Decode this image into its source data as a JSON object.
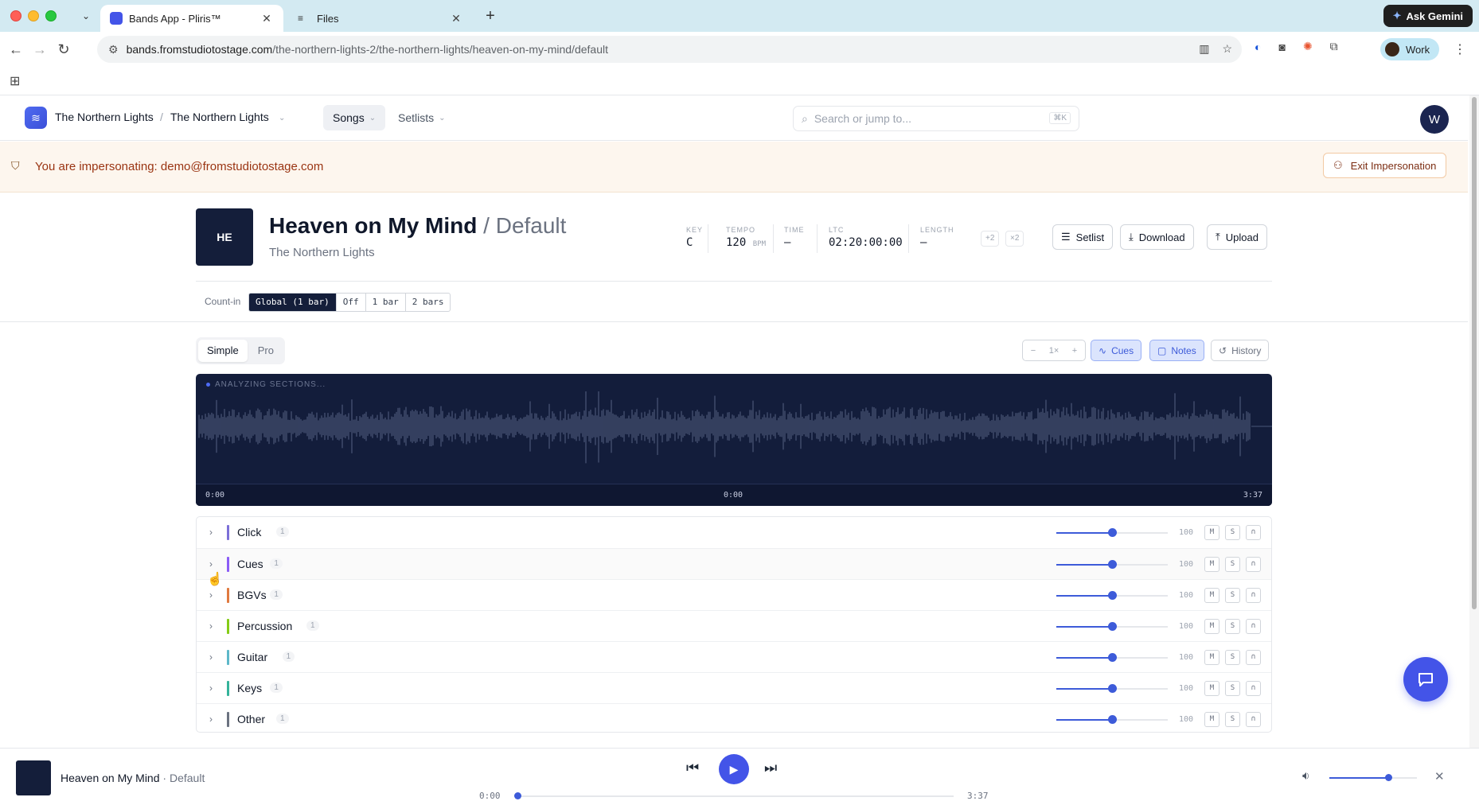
{
  "browser": {
    "tabs": [
      {
        "title": "Bands App - Pliris™",
        "favicon_color": "#4354e8",
        "active": true
      },
      {
        "title": "Files",
        "favicon_icon": "tune-icon",
        "active": false
      }
    ],
    "gemini_label": "Ask Gemini",
    "url_host": "bands.fromstudiotostage.com",
    "url_path": "/the-northern-lights-2/the-northern-lights/heaven-on-my-mind/default",
    "profile_label": "Work"
  },
  "header": {
    "workspace": "The Northern Lights",
    "band": "The Northern Lights",
    "nav": {
      "songs": "Songs",
      "setlists": "Setlists"
    },
    "search_placeholder": "Search or jump to...",
    "search_shortcut": "⌘K",
    "avatar_initial": "W"
  },
  "banner": {
    "text": "You are impersonating: demo@fromstudiotostage.com",
    "exit_label": "Exit Impersonation"
  },
  "song": {
    "art_initials": "HE",
    "title": "Heaven on My Mind",
    "variant_sep": " / ",
    "variant": "Default",
    "band": "The Northern Lights",
    "meta": {
      "key_label": "KEY",
      "key": "C",
      "tempo_label": "TEMPO",
      "tempo": "120",
      "tempo_unit": "BPM",
      "time_label": "TIME",
      "time": "–",
      "ltc_label": "LTC",
      "ltc": "02:20:00:00",
      "length_label": "LENGTH",
      "length": "–"
    },
    "transpose": [
      "+2",
      "×2"
    ],
    "actions": {
      "setlist": "Setlist",
      "download": "Download",
      "upload": "Upload"
    }
  },
  "count_in": {
    "label": "Count-in",
    "options": [
      "Global (1 bar)",
      "Off",
      "1 bar",
      "2 bars"
    ],
    "selected": "Global (1 bar)"
  },
  "mode": {
    "options": [
      "Simple",
      "Pro"
    ],
    "selected": "Simple"
  },
  "view_controls": {
    "zoom_minus": "−",
    "zoom": "1×",
    "zoom_plus": "+",
    "cues": "Cues",
    "notes": "Notes",
    "history": "History",
    "active": [
      "Cues",
      "Notes"
    ]
  },
  "waveform": {
    "status": "ANALYZING SECTIONS...",
    "time_start": "0:00",
    "time_current": "0:00",
    "time_end": "3:37"
  },
  "tracks": [
    {
      "name": "Click",
      "count": "1",
      "color": "#7c6fd8",
      "volume": "100",
      "mute": "M",
      "solo": "S",
      "level": 0.5
    },
    {
      "name": "Cues",
      "count": "1",
      "color": "#8b5cf6",
      "volume": "100",
      "mute": "M",
      "solo": "S",
      "level": 0.5
    },
    {
      "name": "BGVs",
      "count": "1",
      "color": "#e07a3f",
      "volume": "100",
      "mute": "M",
      "solo": "S",
      "level": 0.5
    },
    {
      "name": "Percussion",
      "count": "1",
      "color": "#84cc16",
      "volume": "100",
      "mute": "M",
      "solo": "S",
      "level": 0.5
    },
    {
      "name": "Guitar",
      "count": "1",
      "color": "#5eb8c9",
      "volume": "100",
      "mute": "M",
      "solo": "S",
      "level": 0.5
    },
    {
      "name": "Keys",
      "count": "1",
      "color": "#34b39a",
      "volume": "100",
      "mute": "M",
      "solo": "S",
      "level": 0.5
    },
    {
      "name": "Other",
      "count": "1",
      "color": "#6b7280",
      "volume": "100",
      "mute": "M",
      "solo": "S",
      "level": 0.5
    }
  ],
  "player": {
    "title": "Heaven on My Mind",
    "separator": " · ",
    "variant": "Default",
    "current": "0:00",
    "duration": "3:37",
    "progress": 0,
    "volume_level": 0.67
  }
}
